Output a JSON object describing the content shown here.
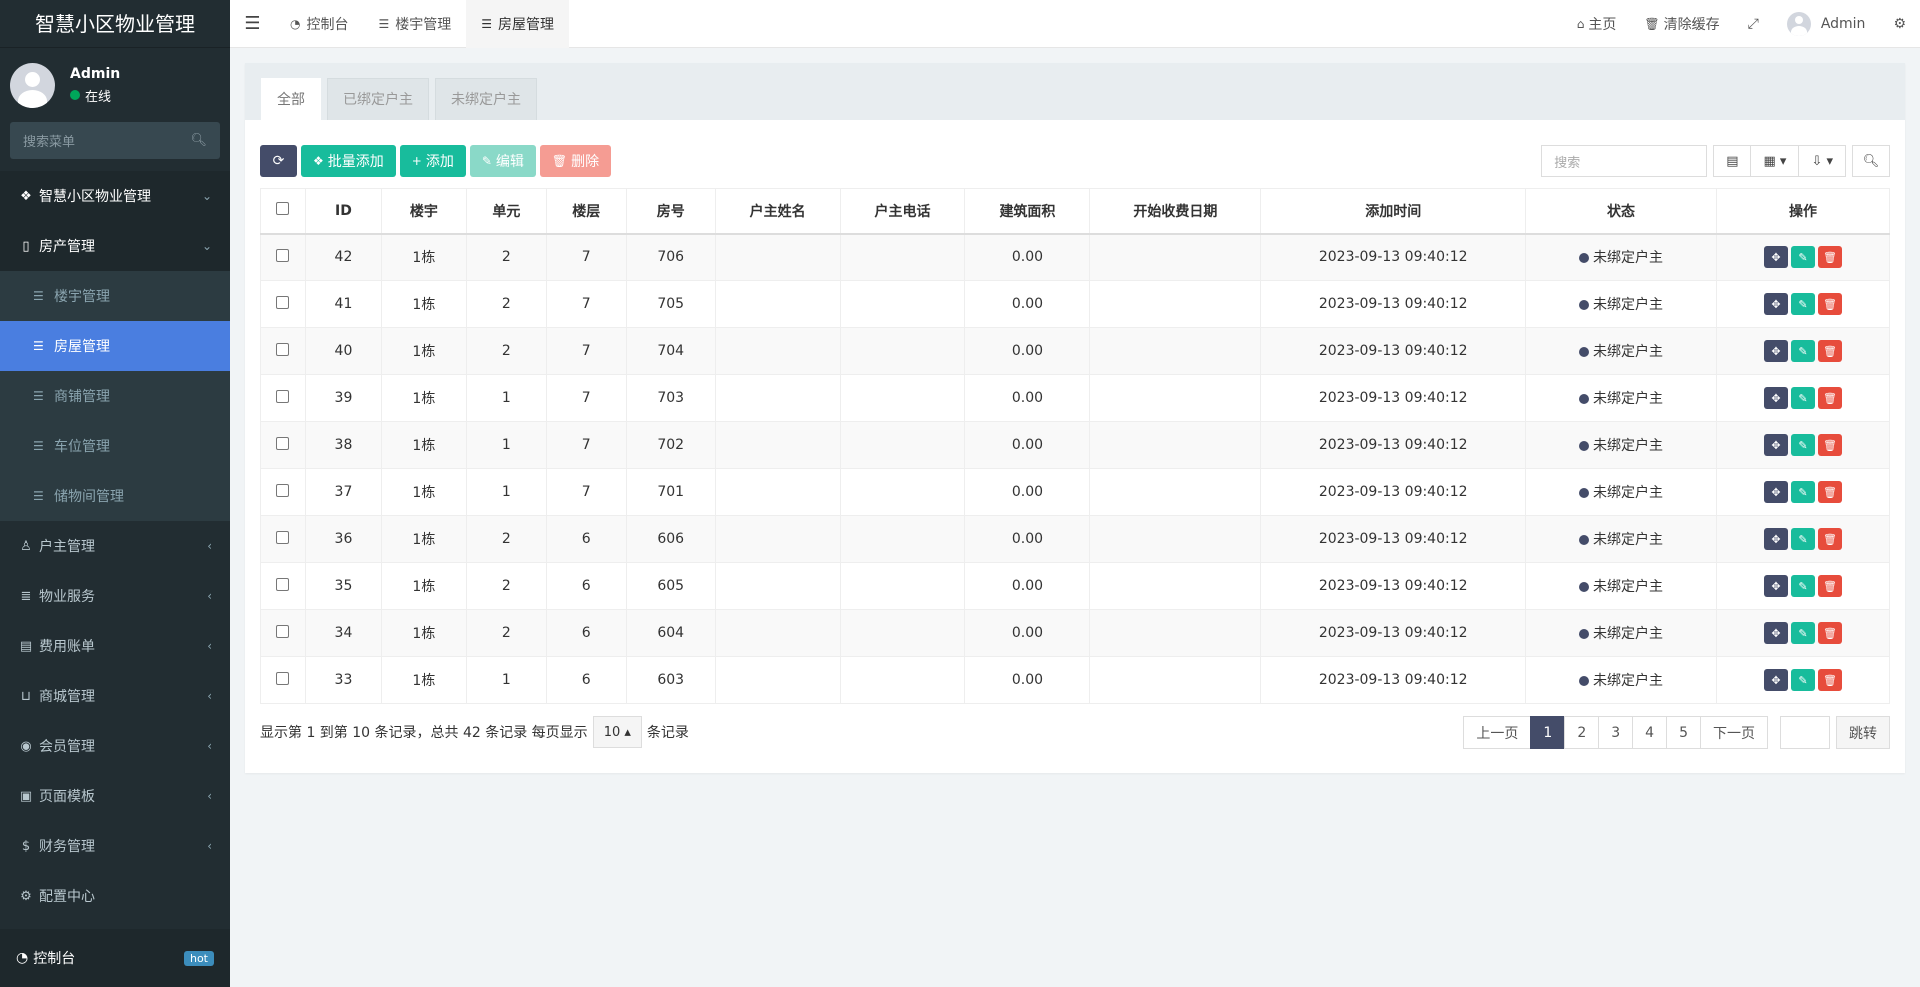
{
  "sidebar": {
    "brand": "智慧小区物业管理",
    "user": {
      "name": "Admin",
      "status": "在线"
    },
    "search_placeholder": "搜索菜单",
    "group_title": "智慧小区物业管理",
    "house_group": "房产管理",
    "sub_items": [
      "楼宇管理",
      "房屋管理",
      "商铺管理",
      "车位管理",
      "储物间管理"
    ],
    "menu_items": [
      "户主管理",
      "物业服务",
      "费用账单",
      "商城管理",
      "会员管理",
      "页面模板",
      "财务管理"
    ],
    "config_item": "配置中心",
    "bottom": {
      "label": "控制台",
      "badge": "hot"
    }
  },
  "header": {
    "tabs": [
      "控制台",
      "楼宇管理",
      "房屋管理"
    ],
    "home": "主页",
    "clear_cache": "清除缓存",
    "user": "Admin"
  },
  "panel": {
    "tabs": [
      "全部",
      "已绑定户主",
      "未绑定户主"
    ],
    "toolbar": {
      "batch_add": "批量添加",
      "add": "添加",
      "edit": "编辑",
      "delete": "删除"
    },
    "search_placeholder": "搜索"
  },
  "table": {
    "columns": [
      "ID",
      "楼宇",
      "单元",
      "楼层",
      "房号",
      "户主姓名",
      "户主电话",
      "建筑面积",
      "开始收费日期",
      "添加时间",
      "状态",
      "操作"
    ],
    "rows": [
      {
        "id": "42",
        "building": "1栋",
        "unit": "2",
        "floor": "7",
        "room": "706",
        "area": "0.00",
        "time": "2023-09-13 09:40:12",
        "status": "未绑定户主"
      },
      {
        "id": "41",
        "building": "1栋",
        "unit": "2",
        "floor": "7",
        "room": "705",
        "area": "0.00",
        "time": "2023-09-13 09:40:12",
        "status": "未绑定户主"
      },
      {
        "id": "40",
        "building": "1栋",
        "unit": "2",
        "floor": "7",
        "room": "704",
        "area": "0.00",
        "time": "2023-09-13 09:40:12",
        "status": "未绑定户主"
      },
      {
        "id": "39",
        "building": "1栋",
        "unit": "1",
        "floor": "7",
        "room": "703",
        "area": "0.00",
        "time": "2023-09-13 09:40:12",
        "status": "未绑定户主"
      },
      {
        "id": "38",
        "building": "1栋",
        "unit": "1",
        "floor": "7",
        "room": "702",
        "area": "0.00",
        "time": "2023-09-13 09:40:12",
        "status": "未绑定户主"
      },
      {
        "id": "37",
        "building": "1栋",
        "unit": "1",
        "floor": "7",
        "room": "701",
        "area": "0.00",
        "time": "2023-09-13 09:40:12",
        "status": "未绑定户主"
      },
      {
        "id": "36",
        "building": "1栋",
        "unit": "2",
        "floor": "6",
        "room": "606",
        "area": "0.00",
        "time": "2023-09-13 09:40:12",
        "status": "未绑定户主"
      },
      {
        "id": "35",
        "building": "1栋",
        "unit": "2",
        "floor": "6",
        "room": "605",
        "area": "0.00",
        "time": "2023-09-13 09:40:12",
        "status": "未绑定户主"
      },
      {
        "id": "34",
        "building": "1栋",
        "unit": "2",
        "floor": "6",
        "room": "604",
        "area": "0.00",
        "time": "2023-09-13 09:40:12",
        "status": "未绑定户主"
      },
      {
        "id": "33",
        "building": "1栋",
        "unit": "1",
        "floor": "6",
        "room": "603",
        "area": "0.00",
        "time": "2023-09-13 09:40:12",
        "status": "未绑定户主"
      }
    ]
  },
  "footer": {
    "info": "显示第 1 到第 10 条记录，总共 42 条记录 每页显示",
    "page_size": "10",
    "info_suffix": "条记录",
    "prev": "上一页",
    "pages": [
      "1",
      "2",
      "3",
      "4",
      "5"
    ],
    "next": "下一页",
    "jump": "跳转"
  }
}
